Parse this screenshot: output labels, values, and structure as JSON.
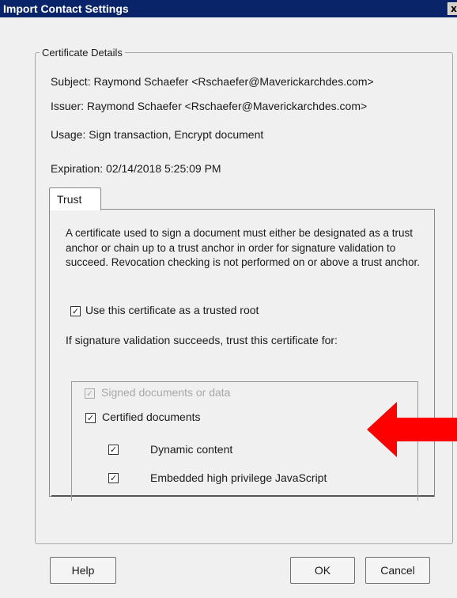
{
  "window": {
    "title": "Import Contact Settings",
    "close_glyph": "x"
  },
  "certificate": {
    "legend": "Certificate Details",
    "subject": "Subject:   Raymond Schaefer <Rschaefer@Maverickarchdes.com>",
    "issuer": "Issuer:   Raymond Schaefer <Rschaefer@Maverickarchdes.com>",
    "usage": "Usage:   Sign transaction, Encrypt document",
    "expiration": "Expiration:   02/14/2018 5:25:09 PM"
  },
  "trust_tab": {
    "label": "Trust",
    "description": "A certificate used to sign a document must either be designated as a trust anchor or chain up to a trust anchor in order for signature validation to succeed.  Revocation checking is not performed on or above a trust anchor.",
    "trusted_root": {
      "label": "Use this certificate as a trusted root",
      "checked": true
    },
    "trust_for_label": "If signature validation succeeds, trust this certificate for:",
    "options": {
      "signed": {
        "label": "Signed documents or data",
        "checked": true,
        "disabled": true
      },
      "certified": {
        "label": "Certified documents",
        "checked": true
      },
      "dynamic": {
        "label": "Dynamic content",
        "checked": true
      },
      "javascript": {
        "label": "Embedded high privilege JavaScript",
        "checked": true
      }
    }
  },
  "buttons": {
    "help": "Help",
    "ok": "OK",
    "cancel": "Cancel"
  },
  "check_glyph": "✓",
  "colors": {
    "titlebar": "#0a246a",
    "annotation_arrow": "#ff0000"
  },
  "annotation": {
    "icon": "red-arrow-left"
  }
}
